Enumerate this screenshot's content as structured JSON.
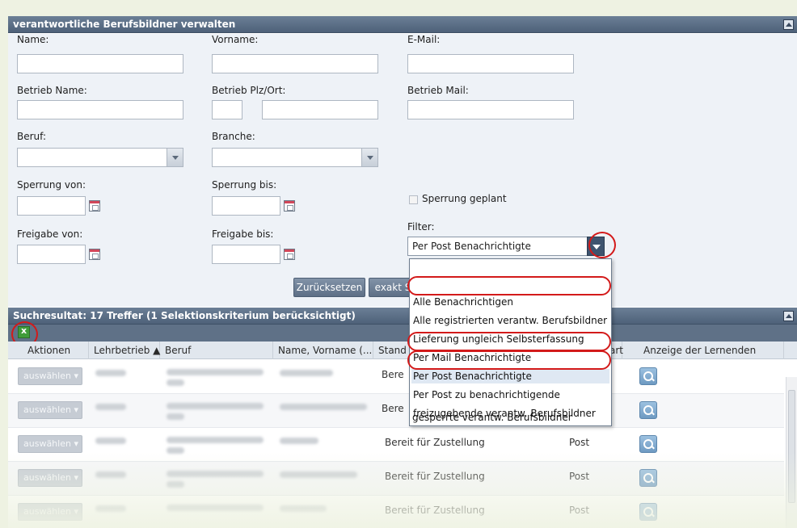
{
  "form_panel": {
    "title": "verantwortliche Berufsbildner verwalten"
  },
  "fields": {
    "name": "Name:",
    "vorname": "Vorname:",
    "email": "E-Mail:",
    "betrieb_name": "Betrieb Name:",
    "betrieb_plz_ort": "Betrieb Plz/Ort:",
    "betrieb_mail": "Betrieb Mail:",
    "beruf": "Beruf:",
    "branche": "Branche:",
    "sperrung_von": "Sperrung von:",
    "sperrung_bis": "Sperrung bis:",
    "sperrung_geplant": "Sperrung geplant",
    "freigabe_von": "Freigabe von:",
    "freigabe_bis": "Freigabe bis:",
    "filter": "Filter:"
  },
  "filter": {
    "selected": "Per Post Benachrichtigte"
  },
  "buttons": {
    "reset": "Zurücksetzen",
    "exact_search": "exakt S"
  },
  "dropdown": {
    "options": [
      "Alle Benachrichtigen",
      "Alle registrierten verantw. Berufsbildner",
      "Lieferung ungleich Selbsterfassung",
      "Per Mail Benachrichtigte",
      "Per Post Benachrichtigte",
      "Per Post zu benachrichtigende",
      "freizugebende verantw. Berufsbildner",
      "gesperrte verantw. Berufsbildner"
    ]
  },
  "results": {
    "title": "Suchresultat: 17 Treffer  (1 Selektionskriterium berücksichtigt)",
    "columns": [
      "Aktionen",
      "Lehrbetrieb ▲",
      "Beruf",
      "Name, Vorname (...",
      "Stand",
      "art",
      "Anzeige der Lernenden"
    ],
    "select_label": "auswählen ▾",
    "rows": [
      {
        "stand": "Bere",
        "art": ""
      },
      {
        "stand": "Bere",
        "art": ""
      },
      {
        "stand": "Bereit für Zustellung",
        "art": "Post"
      },
      {
        "stand": "Bereit für Zustellung",
        "art": "Post"
      },
      {
        "stand": "Bereit für Zustellung",
        "art": "Post"
      }
    ]
  },
  "icons": {
    "collapse": "collapse-up-icon",
    "calendar": "calendar-icon",
    "excel_export": "excel-export-icon",
    "magnifier": "magnifier-icon",
    "combo_arrow": "chevron-down-icon"
  },
  "colors": {
    "header": "#5a6d85",
    "panel_bg": "#eef2f7",
    "highlight": "#d31a1a",
    "page_bg": "#eef2e2"
  }
}
